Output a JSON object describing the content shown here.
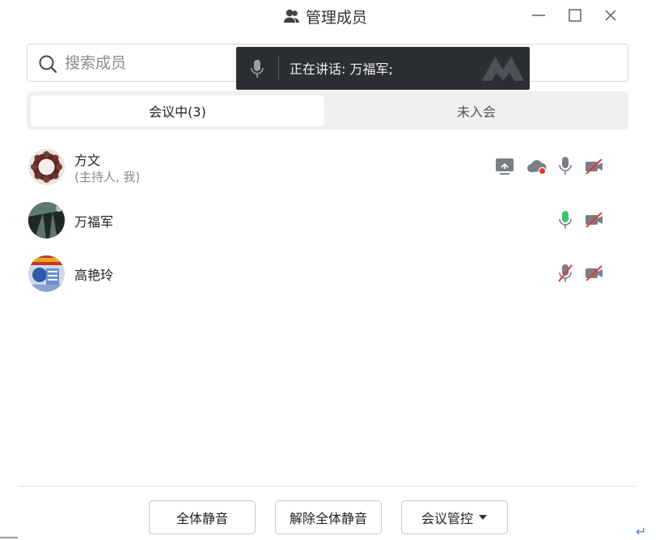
{
  "window": {
    "title": "管理成员"
  },
  "search": {
    "placeholder": "搜索成员",
    "value": ""
  },
  "toast": {
    "text": "正在讲话:  万福军;"
  },
  "tabs": [
    {
      "label": "会议中(3)",
      "active": true
    },
    {
      "label": "未入会",
      "active": false
    }
  ],
  "members": [
    {
      "name": "方文",
      "role": "(主持人, 我)",
      "mic": "on",
      "camera": "off",
      "sharing": true,
      "recording": true
    },
    {
      "name": "万福军",
      "role": "",
      "mic": "speaking",
      "camera": "off",
      "sharing": false,
      "recording": false
    },
    {
      "name": "高艳玲",
      "role": "",
      "mic": "muted",
      "camera": "off",
      "sharing": false,
      "recording": false
    }
  ],
  "footer": {
    "mute_all": "全体静音",
    "unmute_all": "解除全体静音",
    "meeting_control": "会议管控"
  },
  "colors": {
    "speaking_mic": "#3cc46b",
    "record_dot": "#e8352f",
    "muted_slash": "#e8352f",
    "icon_gray": "#7a7f86",
    "toast_bg": "#2b2e33"
  },
  "misc": {
    "return_glyph": "↵"
  }
}
